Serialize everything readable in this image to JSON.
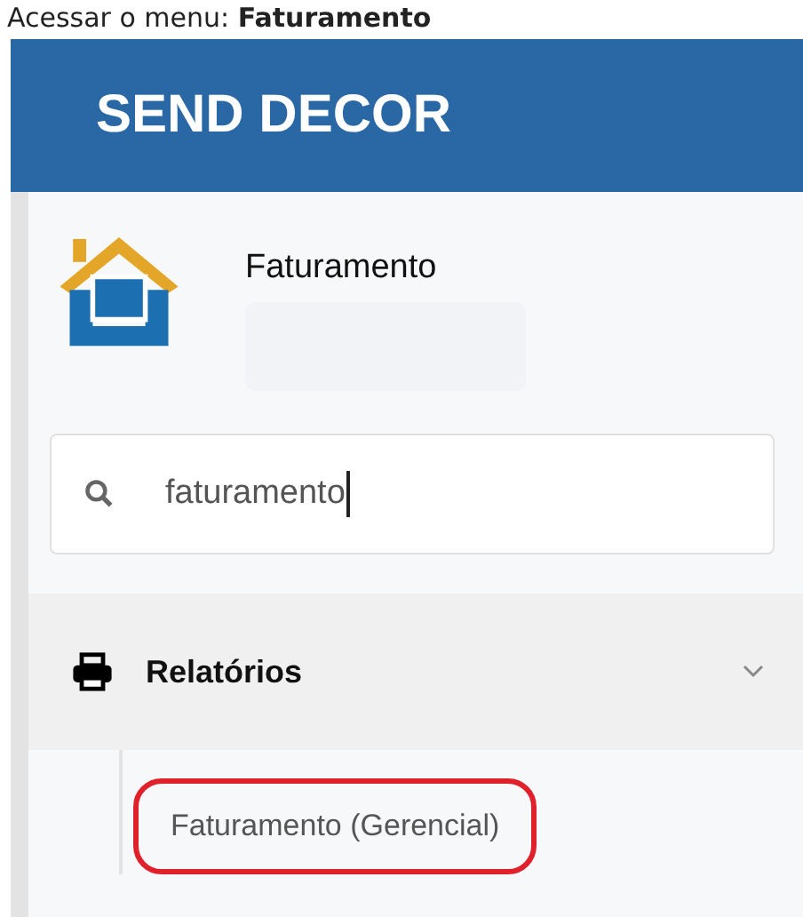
{
  "instruction": "Acessar o menu: **Faturamento**",
  "header": {
    "brand": "SEND DECOR"
  },
  "module": {
    "title": "Faturamento"
  },
  "search": {
    "value": "faturamento"
  },
  "menu": [
    {
      "label": "Relatórios",
      "expanded": true,
      "children": [
        {
          "label": "Faturamento (Gerencial)",
          "highlighted": true
        }
      ]
    }
  ]
}
